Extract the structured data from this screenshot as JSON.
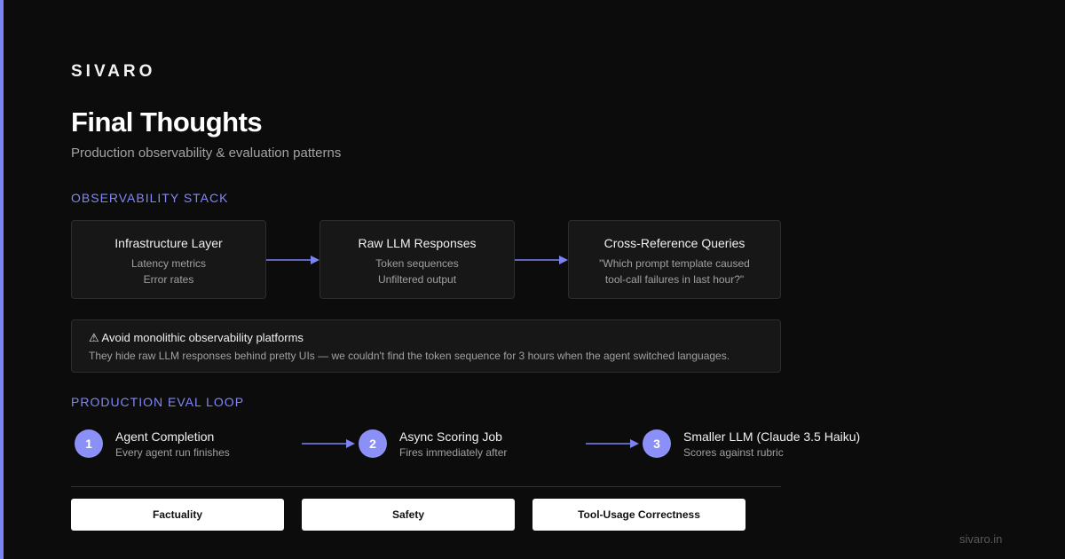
{
  "brand": "SIVARO",
  "title": "Final Thoughts",
  "subtitle": "Production observability & evaluation patterns",
  "observability": {
    "label": "OBSERVABILITY STACK",
    "cards": [
      {
        "title": "Infrastructure Layer",
        "lines": [
          "Latency metrics",
          "Error rates"
        ]
      },
      {
        "title": "Raw LLM Responses",
        "lines": [
          "Token sequences",
          "Unfiltered output"
        ]
      },
      {
        "title": "Cross-Reference Queries",
        "lines": [
          "\"Which prompt template caused",
          "tool-call failures in last hour?\""
        ]
      }
    ]
  },
  "warning": {
    "title": "⚠ Avoid monolithic observability platforms",
    "text": "They hide raw LLM responses behind pretty UIs — we couldn't find the token sequence for 3 hours when the agent switched languages."
  },
  "eval_loop": {
    "label": "PRODUCTION EVAL LOOP",
    "steps": [
      {
        "number": "1",
        "title": "Agent Completion",
        "desc": "Every agent run finishes"
      },
      {
        "number": "2",
        "title": "Async Scoring Job",
        "desc": "Fires immediately after"
      },
      {
        "number": "3",
        "title": "Smaller LLM (Claude 3.5 Haiku)",
        "desc": "Scores against rubric"
      }
    ]
  },
  "criteria": [
    "Factuality",
    "Safety",
    "Tool-Usage Correctness"
  ],
  "footer_url": "sivaro.in",
  "colors": {
    "accent": "#7c83f3",
    "step_circle": "#8a90f5",
    "background": "#0c0c0c",
    "card": "#171717"
  }
}
